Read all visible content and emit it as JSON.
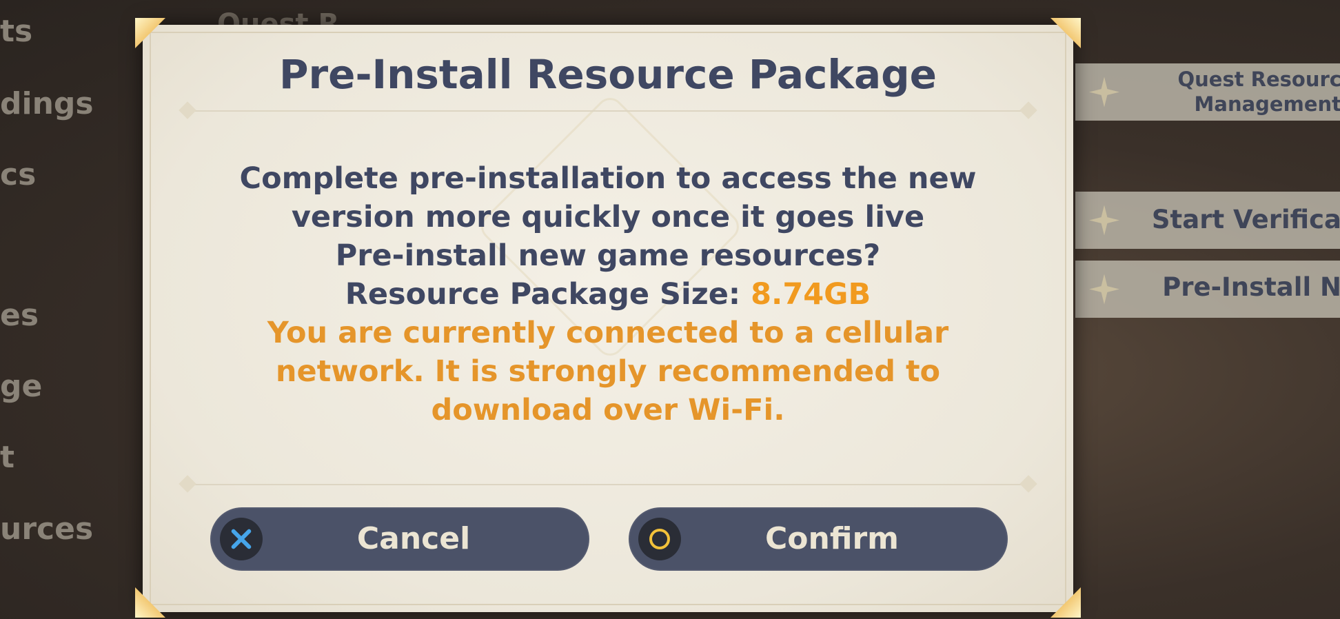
{
  "background": {
    "top_partial_title": "Quest R",
    "left_menu": [
      {
        "id": "item1",
        "text": "ts"
      },
      {
        "id": "item2",
        "text": "dings"
      },
      {
        "id": "item3",
        "text": "cs"
      },
      {
        "id": "item4",
        "text": "es"
      },
      {
        "id": "item5",
        "text": "ge"
      },
      {
        "id": "item6",
        "text": "t"
      },
      {
        "id": "item7",
        "text": "urces"
      }
    ],
    "right_panel": {
      "quest_resource_line1": "Quest Resourc",
      "quest_resource_line2": "Management",
      "start_verification": "Start Verifica",
      "pre_install": "Pre-Install N"
    }
  },
  "dialog": {
    "title": "Pre-Install Resource Package",
    "line1": "Complete pre-installation to access the new",
    "line2": "version more quickly once it goes live",
    "line3": "Pre-install new game resources?",
    "size_label": "Resource Package Size: ",
    "size_value": "8.74GB",
    "warning_line1": "You are currently connected to a cellular",
    "warning_line2": "network. It is strongly recommended to",
    "warning_line3": "download over Wi-Fi.",
    "cancel_label": "Cancel",
    "confirm_label": "Confirm"
  },
  "colors": {
    "accent_orange": "#f19a1f",
    "button_bg": "#4b5268",
    "title_text": "#3f4762",
    "cancel_icon": "#46a5ea",
    "confirm_icon": "#f2c13a"
  },
  "icons": {
    "cancel": "cross-button-icon",
    "confirm": "circle-button-icon"
  }
}
